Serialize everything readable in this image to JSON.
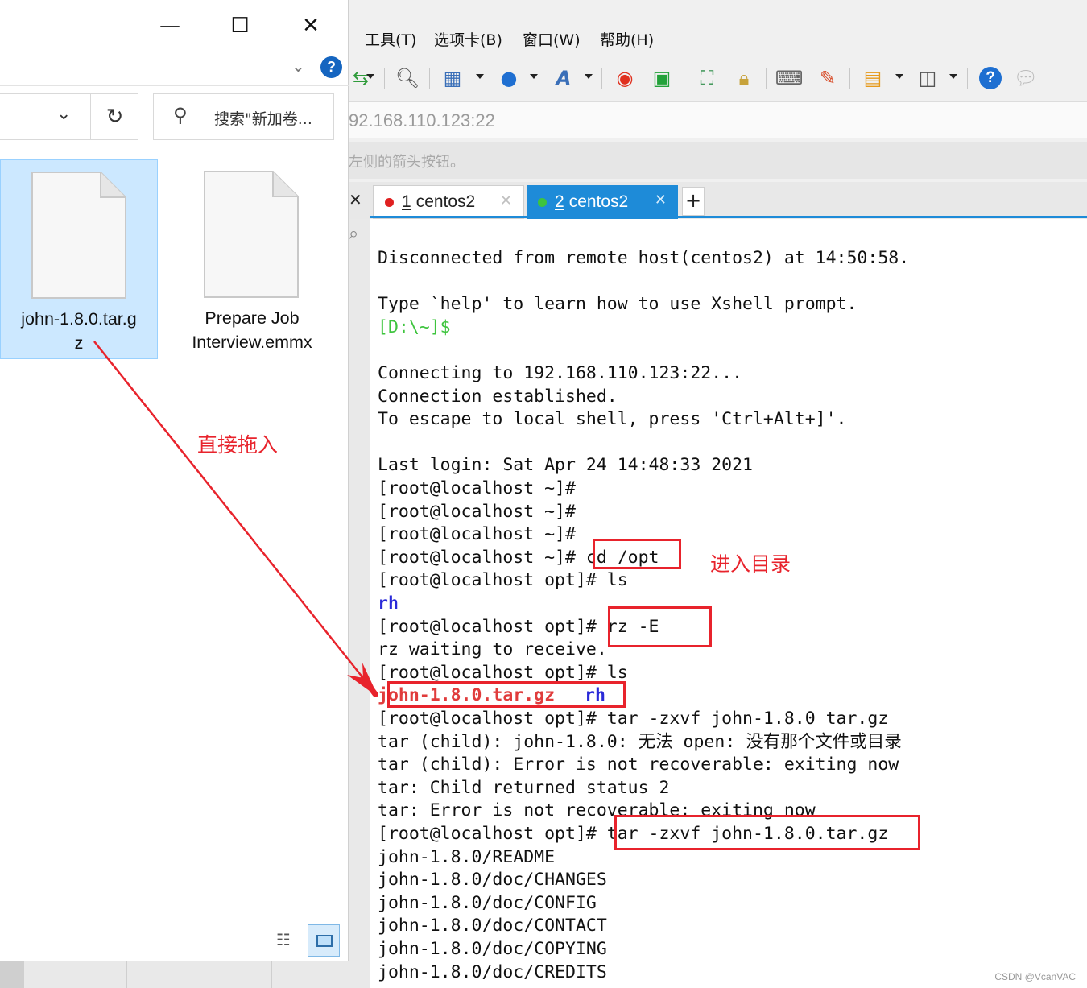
{
  "xshell": {
    "menu": [
      "工具(T)",
      "选项卡(B)",
      "窗口(W)",
      "帮助(H)"
    ],
    "toolbar_icons": [
      "transfer-icon",
      "search-icon",
      "session-icon",
      "globe-icon",
      "font-icon",
      "xftp-icon",
      "xagent-icon",
      "fullscreen-icon",
      "lock-icon",
      "keyboard-icon",
      "highlight-icon",
      "new-folder-icon",
      "layout-icon",
      "help-icon",
      "chat-icon"
    ],
    "address": "92.168.110.123:22",
    "hint": "左侧的箭头按钮。",
    "tabs": [
      {
        "number": "1",
        "label": "centos2",
        "status_color": "#e02020",
        "active": false
      },
      {
        "number": "2",
        "label": "centos2",
        "status_color": "#3ec43e",
        "active": true
      }
    ],
    "new_tab": "+",
    "terminal_lines": [
      {
        "text": "Disconnected from remote host(centos2) at 14:50:58.",
        "style": ""
      },
      {
        "text": "",
        "style": ""
      },
      {
        "text": "Type `help' to learn how to use Xshell prompt.",
        "style": ""
      },
      {
        "text": "[D:\\~]$",
        "style": "green"
      },
      {
        "text": "",
        "style": ""
      },
      {
        "text": "Connecting to 192.168.110.123:22...",
        "style": ""
      },
      {
        "text": "Connection established.",
        "style": ""
      },
      {
        "text": "To escape to local shell, press 'Ctrl+Alt+]'.",
        "style": ""
      },
      {
        "text": "",
        "style": ""
      },
      {
        "text": "Last login: Sat Apr 24 14:48:33 2021",
        "style": ""
      },
      {
        "text": "[root@localhost ~]#",
        "style": ""
      },
      {
        "text": "[root@localhost ~]#",
        "style": ""
      },
      {
        "text": "[root@localhost ~]#",
        "style": ""
      },
      {
        "text": "[root@localhost ~]# cd /opt",
        "style": ""
      },
      {
        "text": "[root@localhost opt]# ls",
        "style": ""
      },
      {
        "text": "rh",
        "style": "blue"
      },
      {
        "text": "[root@localhost opt]# rz -E",
        "style": ""
      },
      {
        "text": "rz waiting to receive.",
        "style": ""
      },
      {
        "text": "[root@localhost opt]# ls",
        "style": ""
      },
      {
        "text": "john-1.8.0.tar.gz",
        "style": "red",
        "extra": "rh"
      },
      {
        "text": "[root@localhost opt]# tar -zxvf john-1.8.0 tar.gz",
        "style": ""
      },
      {
        "text": "tar (child): john-1.8.0: 无法 open: 没有那个文件或目录",
        "style": ""
      },
      {
        "text": "tar (child): Error is not recoverable: exiting now",
        "style": ""
      },
      {
        "text": "tar: Child returned status 2",
        "style": ""
      },
      {
        "text": "tar: Error is not recoverable: exiting now",
        "style": ""
      },
      {
        "text": "[root@localhost opt]# tar -zxvf john-1.8.0.tar.gz",
        "style": ""
      },
      {
        "text": "john-1.8.0/README",
        "style": ""
      },
      {
        "text": "john-1.8.0/doc/CHANGES",
        "style": ""
      },
      {
        "text": "john-1.8.0/doc/CONFIG",
        "style": ""
      },
      {
        "text": "john-1.8.0/doc/CONTACT",
        "style": ""
      },
      {
        "text": "john-1.8.0/doc/COPYING",
        "style": ""
      },
      {
        "text": "john-1.8.0/doc/CREDITS",
        "style": ""
      }
    ]
  },
  "explorer": {
    "window_controls": {
      "minimize": "—",
      "maximize": "☐",
      "close": "✕"
    },
    "search_placeholder": "搜索\"新加卷...",
    "files": [
      {
        "name_line1": "john-1.8.0.tar.g",
        "name_line2": "z",
        "selected": true
      },
      {
        "name_line1": "Prepare Job",
        "name_line2": "Interview.emmx",
        "selected": false
      }
    ]
  },
  "annotations": {
    "drag_label": "直接拖入",
    "enter_dir_label": "进入目录",
    "color": "#e8232c"
  },
  "watermark": "CSDN @VcanVAC"
}
